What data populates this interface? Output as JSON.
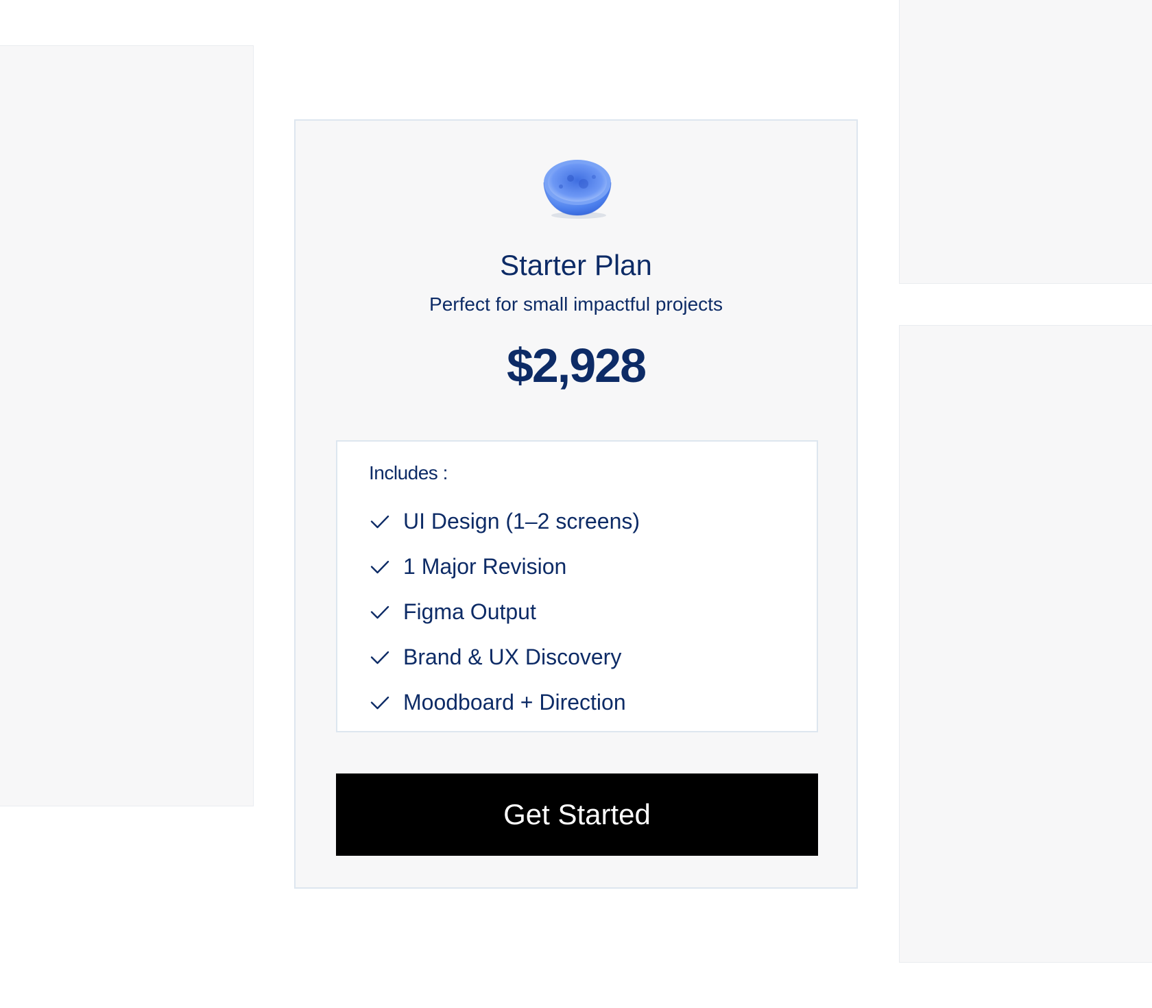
{
  "plan": {
    "name": "Starter Plan",
    "description": "Perfect for small impactful projects",
    "price": "$2,928",
    "icon": "blue-bowl-icon"
  },
  "includes": {
    "title": "Includes :",
    "items": [
      "UI Design (1–2 screens)",
      "1 Major Revision",
      "Figma Output",
      "Brand & UX Discovery",
      "Moodboard + Direction"
    ]
  },
  "cta": {
    "label": "Get Started"
  },
  "colors": {
    "text": "#0d2b66",
    "button_bg": "#000000",
    "card_bg": "#f7f7f8",
    "border": "#dde6ef"
  }
}
